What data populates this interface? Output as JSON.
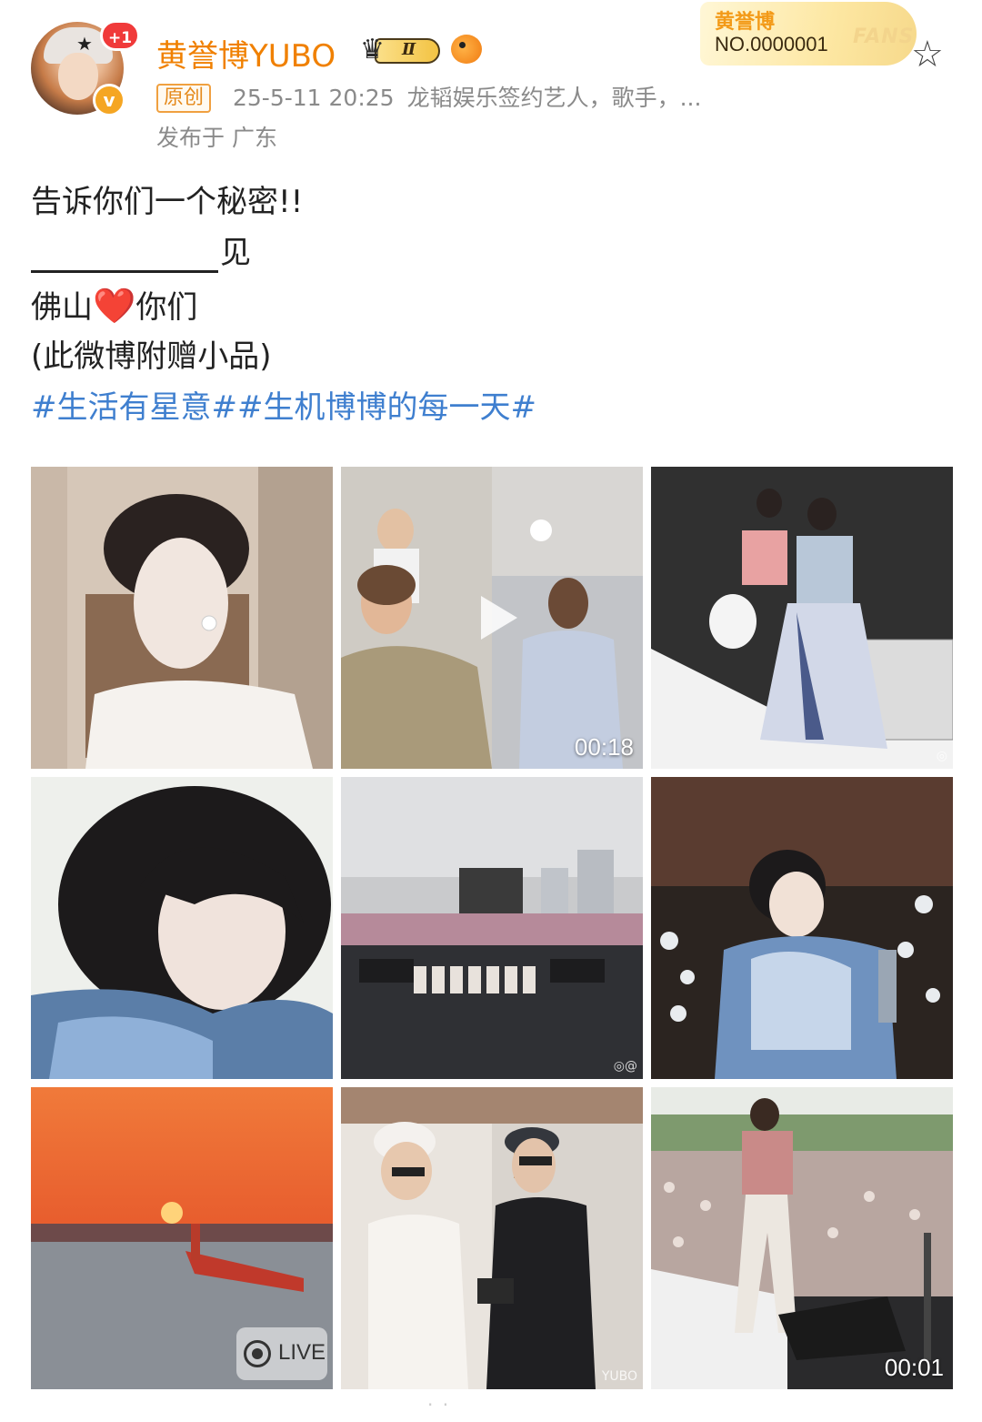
{
  "header": {
    "notification_count": "+1",
    "username": "黄誉博YUBO",
    "vip_level": "Ⅱ",
    "fans_card": {
      "name": "黄誉博",
      "number": "NO.0000001",
      "label": "FANS"
    },
    "original_tag": "原创",
    "timestamp": "25-5-11 20:25",
    "description": "龙韬娱乐签约艺人，歌手，...",
    "location": "发布于 广东"
  },
  "post": {
    "line1": "告诉你们一个秘密!!",
    "line2_suffix": "见",
    "line3_before": "佛山",
    "line3_heart": "❤️",
    "line3_after": "你们",
    "line4": "(此微博附赠小品)",
    "hashtags": "#生活有星意##生机博博的每一天#"
  },
  "media": {
    "video1_duration": "00:18",
    "live_label": "LIVE",
    "video2_duration": "00:01"
  },
  "colors": {
    "username": "#f08000",
    "hashtag": "#3f7fcf",
    "meta": "#8a8a8a"
  }
}
